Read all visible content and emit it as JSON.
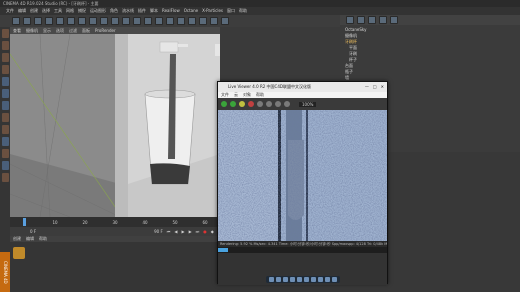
{
  "window": {
    "title": "CINEMA 4D R19.024 Studio (RC) - [牙刷杯] - 主要"
  },
  "menubar": {
    "items": [
      "文件",
      "编辑",
      "创建",
      "选择",
      "工具",
      "网格",
      "捕捉",
      "运动图形",
      "角色",
      "流水线",
      "插件",
      "脚本",
      "RealFlow",
      "Octane",
      "X-Particles",
      "窗口",
      "帮助"
    ]
  },
  "viewport": {
    "menu": [
      "查看",
      "摄像机",
      "显示",
      "选项",
      "过滤",
      "面板",
      "ProRender"
    ]
  },
  "object_tree": {
    "items": [
      "OctaneSky",
      "摄像机",
      "牙刷杯",
      "平面",
      "牙刷",
      "杯子",
      "台面",
      "瓶子",
      "墙"
    ]
  },
  "viewer": {
    "title": "Live Viewer 4.0 R2 中国C4D联盟中文汉化版",
    "menu": [
      "文件",
      "云",
      "对象",
      "帮助"
    ],
    "zoom": "100%",
    "status": "Rendering: 5.92 % Ms/sec: 4.341  Time: 小时:分钟:秒/小时:分钟:秒  Spp/maxspp: 4/128  Tri: 0/48k  Mesh: 6  Hair: 0  RTX:off",
    "progress": 0.06
  },
  "timeline": {
    "ticks": [
      "0",
      "10",
      "20",
      "30",
      "40",
      "50",
      "60",
      "70",
      "80",
      "90",
      "100"
    ],
    "frame": "0 F",
    "end": "90 F"
  },
  "coords": {
    "headers": [
      "位置",
      "尺寸",
      "旋转"
    ],
    "rows": [
      "X 0 cm",
      "Y 0 cm",
      "Z 0 cm"
    ],
    "apply": "应用"
  },
  "logo": "CINEMA 4D"
}
